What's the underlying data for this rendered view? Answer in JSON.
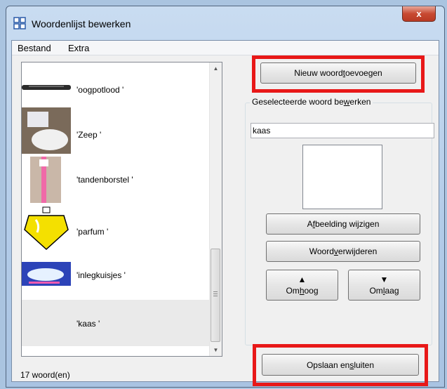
{
  "window": {
    "title": "Woordenlijst bewerken",
    "close_label": "x"
  },
  "menu": [
    "Bestand",
    "Extra"
  ],
  "words": [
    {
      "label": "'oogpotlood '",
      "icon": "pencil-image"
    },
    {
      "label": "'Zeep '",
      "icon": "soap-image"
    },
    {
      "label": "'tandenborstel '",
      "icon": "toothbrush-image"
    },
    {
      "label": "'parfum '",
      "icon": "perfume-image"
    },
    {
      "label": "'inlegkuisjes '",
      "icon": "pads-image"
    },
    {
      "label": "'kaas '",
      "icon": "none",
      "selected": true
    }
  ],
  "buttons": {
    "new_word": {
      "pre": "Nieuw woord ",
      "ul": "t",
      "post": "oevoegen"
    },
    "change_image": {
      "pre": "A",
      "ul": "f",
      "post": "beelding wijzigen"
    },
    "delete_word": {
      "pre": "Woord ",
      "ul": "v",
      "post": "erwijderen"
    },
    "up": {
      "pre": "Om",
      "ul": "h",
      "post": "oog"
    },
    "down": {
      "pre": "Om",
      "ul": "l",
      "post": "aag"
    },
    "save_close": {
      "pre": "Opslaan en ",
      "ul": "s",
      "post": "luiten"
    }
  },
  "group": {
    "pre": "Geselecteerde woord be",
    "ul": "w",
    "post": "erken"
  },
  "edit": {
    "value": "kaas "
  },
  "status": {
    "count": "17 woord(en)"
  },
  "colors": {
    "highlight": "#e81818",
    "close": "#c84a32"
  }
}
